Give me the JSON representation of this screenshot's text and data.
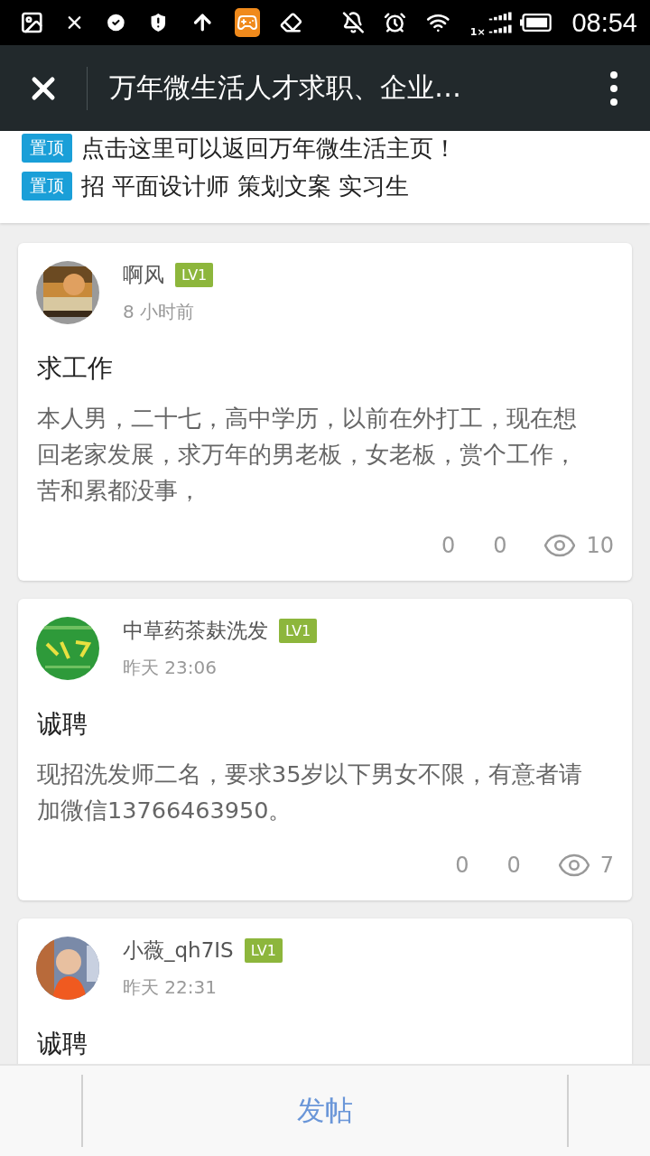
{
  "status_bar": {
    "network_label": "1×",
    "time": "08:54"
  },
  "header": {
    "title": "万年微生活人才求职、企业…"
  },
  "pinned": [
    {
      "badge": "置顶",
      "text": "点击这里可以返回万年微生活主页！"
    },
    {
      "badge": "置顶",
      "text": "招 平面设计师 策划文案 实习生"
    }
  ],
  "posts": [
    {
      "author": "啊风",
      "level_badge": "LV1",
      "time": "8 小时前",
      "title": "求工作",
      "body": "本人男，二十七，高中学历，以前在外打工，现在想回老家发展，求万年的男老板，女老板，赏个工作，苦和累都没事，",
      "stats": {
        "stat_1": "0",
        "stat_2": "0",
        "views": "10"
      }
    },
    {
      "author": "中草药茶麸洗发",
      "level_badge": "LV1",
      "time": "昨天 23:06",
      "title": "诚聘",
      "body": "现招洗发师二名，要求35岁以下男女不限，有意者请加微信13766463950。",
      "stats": {
        "stat_1": "0",
        "stat_2": "0",
        "views": "7"
      }
    },
    {
      "author": "小薇_qh7IS",
      "level_badge": "LV1",
      "time": "昨天 22:31",
      "title": "诚聘"
    }
  ],
  "bottom_bar": {
    "button": "发帖"
  }
}
